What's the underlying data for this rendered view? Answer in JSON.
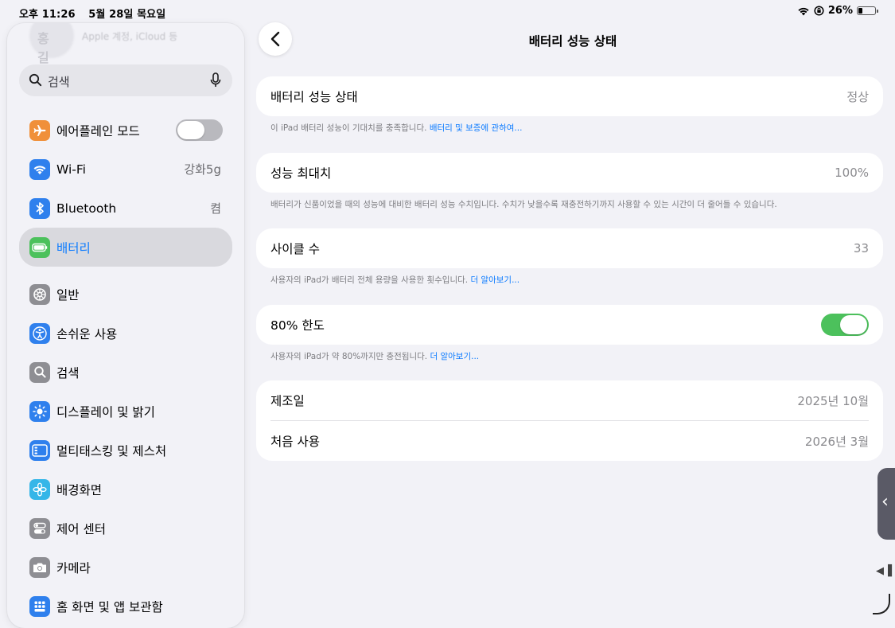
{
  "status_bar": {
    "time": "오후 11:26",
    "date": "5월 28일 목요일",
    "battery_pct": "26%",
    "battery_level": 0.26
  },
  "sidebar": {
    "profile": {
      "name": "홍길",
      "subtitle": "Apple 계정, iCloud 등"
    },
    "search": {
      "placeholder": "검색"
    },
    "items": [
      {
        "label": "에어플레인 모드",
        "icon": "airplane-icon",
        "color": "#f0903a"
      },
      {
        "label": "Wi-Fi",
        "value": "강화5g",
        "icon": "wifi-icon",
        "color": "#2f80ed"
      },
      {
        "label": "Bluetooth",
        "value": "켬",
        "icon": "bluetooth-icon",
        "color": "#2f80ed"
      },
      {
        "label": "배터리",
        "icon": "battery-icon",
        "color": "#4cc15c"
      },
      {
        "label": "일반",
        "icon": "gear-icon",
        "color": "#8e8e93"
      },
      {
        "label": "손쉬운 사용",
        "icon": "accessibility-icon",
        "color": "#2f80ed"
      },
      {
        "label": "검색",
        "icon": "search-icon",
        "color": "#8e8e93"
      },
      {
        "label": "디스플레이 및 밝기",
        "icon": "sun-icon",
        "color": "#2f80ed"
      },
      {
        "label": "멀티태스킹 및 제스처",
        "icon": "multitasking-icon",
        "color": "#2f80ed"
      },
      {
        "label": "배경화면",
        "icon": "flower-icon",
        "color": "#35b6e8"
      },
      {
        "label": "제어 센터",
        "icon": "toggles-icon",
        "color": "#8e8e93"
      },
      {
        "label": "카메라",
        "icon": "camera-icon",
        "color": "#8e8e93"
      },
      {
        "label": "홈 화면 및 앱 보관함",
        "icon": "home-screen-icon",
        "color": "#2f80ed"
      }
    ]
  },
  "main": {
    "title": "배터리 성능 상태",
    "health": {
      "label": "배터리 성능 상태",
      "value": "정상",
      "footnote": "이 iPad 배터리 성능이 기대치를 충족합니다. ",
      "footnote_link": "배터리 및 보증에 관하여..."
    },
    "max_capacity": {
      "label": "성능 최대치",
      "value": "100%",
      "footnote": "배터리가 신품이었을 때의 성능에 대비한 배터리 성능 수치입니다. 수치가 낮을수록 재충전하기까지 사용할 수 있는 시간이 더 줄어들 수 있습니다."
    },
    "cycle_count": {
      "label": "사이클 수",
      "value": "33",
      "footnote": "사용자의 iPad가 배터리 전체 용량을 사용한 횟수입니다. ",
      "footnote_link": "더 알아보기..."
    },
    "limit_80": {
      "label": "80% 한도",
      "enabled": true,
      "footnote": "사용자의 iPad가 약 80%까지만 충전됩니다. ",
      "footnote_link": "더 알아보기..."
    },
    "manufacture": {
      "label": "제조일",
      "value": "2025년 10월"
    },
    "first_use": {
      "label": "처음 사용",
      "value": "2026년 3월"
    }
  }
}
